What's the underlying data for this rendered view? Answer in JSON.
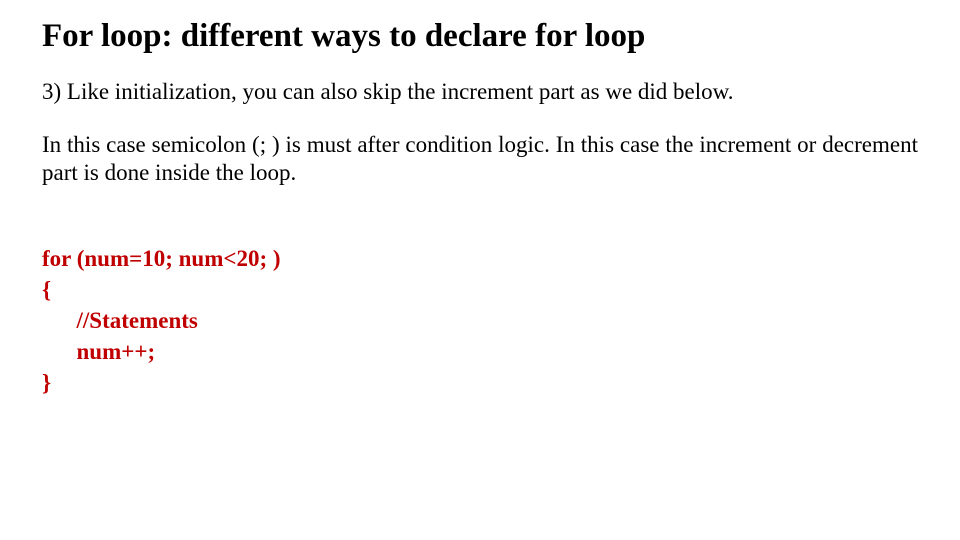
{
  "title": "For loop: different ways to declare for loop",
  "para1": "3) Like initialization, you can also skip the increment part as we did below.",
  "para2": "In this case semicolon (; ) is must after condition logic. In this case the increment or decrement part is done inside the loop.",
  "code": {
    "l1": "for (num=10; num<20; )",
    "l2": "{",
    "l3": "      //Statements",
    "l4": "      num++;",
    "l5": "}"
  }
}
